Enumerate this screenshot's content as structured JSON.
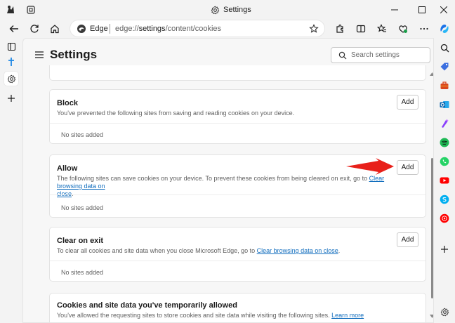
{
  "window": {
    "title": "Settings",
    "controls": [
      "minimize-icon",
      "maximize-icon",
      "close-icon"
    ]
  },
  "toolbar": {
    "site_label": "Edge",
    "url_prefix": "edge://",
    "url_host": "settings",
    "url_path": "/content/cookies"
  },
  "page": {
    "title": "Settings",
    "search_placeholder": "Search settings"
  },
  "sections": [
    {
      "title": "Block",
      "description": "You've prevented the following sites from saving and reading cookies on your device.",
      "button": "Add",
      "empty_text": "No sites added"
    },
    {
      "title": "Allow",
      "description": "The following sites can save cookies on your device. To prevent these cookies from being cleared on exit, go to ",
      "link": "Clear browsing data on close",
      "link_part1": "Clear browsing data on",
      "link_part2": "close",
      "description_end": ".",
      "button": "Add",
      "empty_text": "No sites added"
    },
    {
      "title": "Clear on exit",
      "description": "To clear all cookies and site data when you close Microsoft Edge, go to ",
      "link": "Clear browsing data on close",
      "description_end": ".",
      "button": "Add",
      "empty_text": "No sites added"
    },
    {
      "title": "Cookies and site data you've temporarily allowed",
      "description": "You've allowed the requesting sites to store cookies and site data while visiting the following sites. ",
      "link": "Learn more"
    }
  ],
  "colors": {
    "accent": "#0f6cbd",
    "annotation_arrow": "#e8201a",
    "copilot": "#1a73e8"
  }
}
